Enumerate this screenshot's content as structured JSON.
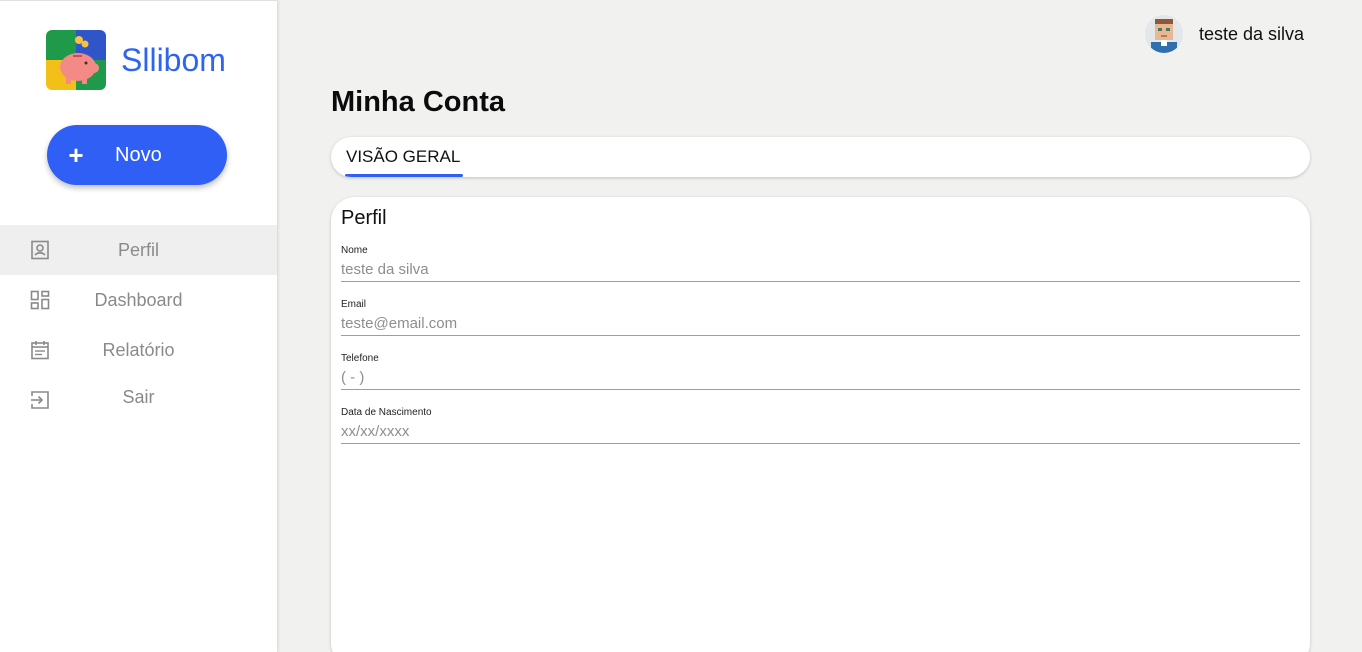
{
  "brand": {
    "name": "Sllibom",
    "color": "#2f63f2"
  },
  "new_button": {
    "icon": "plus-icon",
    "label": "Novo",
    "color": "#2f5ff5"
  },
  "nav": {
    "items": [
      {
        "label": "Perfil",
        "icon": "profile-icon",
        "active": true
      },
      {
        "label": "Dashboard",
        "icon": "dashboard-icon",
        "active": false
      },
      {
        "label": "Relatório",
        "icon": "calendar-icon",
        "active": false
      },
      {
        "label": "Sair",
        "icon": "logout-icon",
        "active": false
      }
    ]
  },
  "user": {
    "name": "teste da silva",
    "avatar_icon": "avatar"
  },
  "page": {
    "title": "Minha Conta"
  },
  "tabs": [
    {
      "label": "VISÃO GERAL",
      "active": true
    }
  ],
  "profile_card": {
    "title": "Perfil",
    "fields": [
      {
        "label": "Nome",
        "placeholder": "teste da silva"
      },
      {
        "label": "Email",
        "placeholder": "teste@email.com"
      },
      {
        "label": "Telefone",
        "placeholder": "( - )"
      },
      {
        "label": "Data de Nascimento",
        "placeholder": "xx/xx/xxxx"
      }
    ]
  }
}
